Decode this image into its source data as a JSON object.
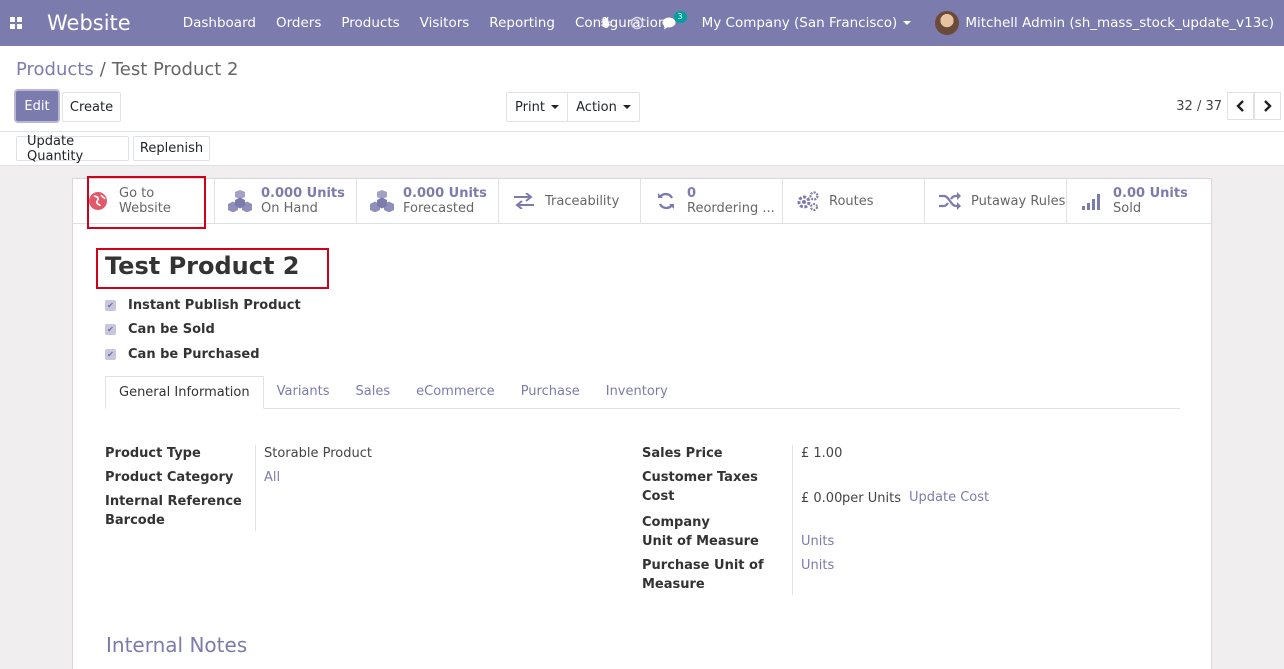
{
  "navbar": {
    "app_title": "Website",
    "menu": [
      "Dashboard",
      "Orders",
      "Products",
      "Visitors",
      "Reporting",
      "Configuration"
    ],
    "chat_badge": "3",
    "company": "My Company (San Francisco)",
    "user": "Mitchell Admin (sh_mass_stock_update_v13c)"
  },
  "breadcrumb": {
    "parent": "Products",
    "separator": "/",
    "current": "Test Product 2"
  },
  "toolbar": {
    "edit": "Edit",
    "create": "Create",
    "print": "Print",
    "action": "Action"
  },
  "pager": {
    "value": "32 / 37"
  },
  "statusbar": {
    "update_quantity": "Update Quantity",
    "replenish": "Replenish"
  },
  "smart_buttons": [
    {
      "value": "",
      "label": "Go to Website",
      "line1": "Go to",
      "line2": "Website",
      "icon": "globe-icon"
    },
    {
      "value": "0.000 Units",
      "label": "On Hand",
      "icon": "cubes-icon"
    },
    {
      "value": "0.000 Units",
      "label": "Forecasted",
      "icon": "cubes-icon"
    },
    {
      "value": "",
      "label": "Traceability",
      "icon": "exchange-icon"
    },
    {
      "value": "0",
      "label": "Reordering ...",
      "icon": "refresh-icon"
    },
    {
      "value": "",
      "label": "Routes",
      "icon": "cogs-icon"
    },
    {
      "value": "",
      "label": "Putaway Rules",
      "icon": "random-icon"
    },
    {
      "value": "0.00 Units",
      "label": "Sold",
      "icon": "signal-icon"
    }
  ],
  "product": {
    "name": "Test Product 2",
    "checkboxes": [
      "Instant Publish Product",
      "Can be Sold",
      "Can be Purchased"
    ]
  },
  "tabs": [
    "General Information",
    "Variants",
    "Sales",
    "eCommerce",
    "Purchase",
    "Inventory"
  ],
  "general": {
    "product_type_label": "Product Type",
    "product_type": "Storable Product",
    "category_label": "Product Category",
    "category": "All",
    "internal_ref_label": "Internal Reference",
    "barcode_label": "Barcode",
    "sales_price_label": "Sales Price",
    "sales_price": "£ 1.00",
    "customer_taxes_label": "Customer Taxes",
    "cost_label": "Cost",
    "cost": "£ 0.00",
    "cost_unit": "per Units",
    "update_cost": "Update Cost",
    "company_label": "Company",
    "uom_label": "Unit of Measure",
    "uom": "Units",
    "purchase_uom_label_1": "Purchase Unit of",
    "purchase_uom_label_2": "Measure",
    "purchase_uom": "Units"
  },
  "notes": {
    "title": "Internal Notes"
  },
  "colors": {
    "brand": "#7c7bad",
    "highlight": "#d0021b",
    "badge": "#00a09d"
  }
}
